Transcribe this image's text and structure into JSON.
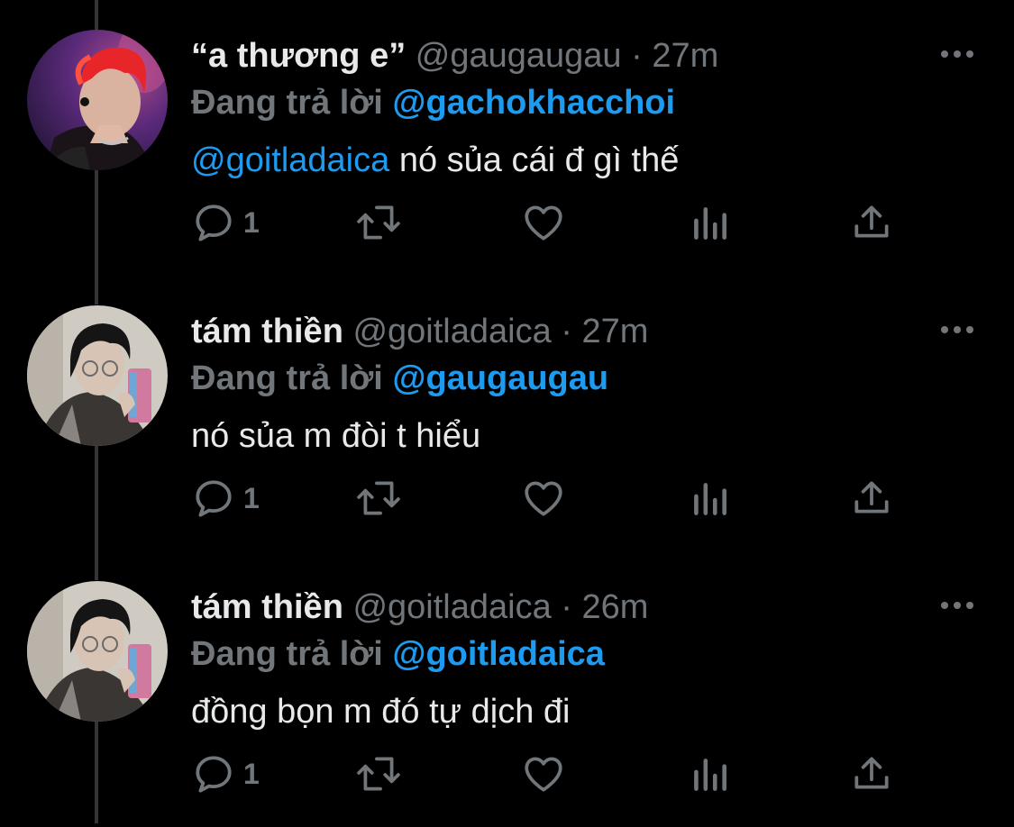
{
  "tweets": [
    {
      "display_name": "“a thương e”",
      "handle": "@gaugaugau",
      "separator": "·",
      "time": "27m",
      "reply_prefix": "Đang trả lời",
      "reply_to": "@gachokhacchoi",
      "mention": "@goitladaica",
      "body": "nó sủa cái đ gì thế",
      "reply_count": "1",
      "avatar": "red-hair-performer-avatar"
    },
    {
      "display_name": "tám thiền",
      "handle": "@goitladaica",
      "separator": "·",
      "time": "27m",
      "reply_prefix": "Đang trả lời",
      "reply_to": "@gaugaugau",
      "mention": "",
      "body": "nó sủa m đòi t hiểu",
      "reply_count": "1",
      "avatar": "mirror-selfie-avatar"
    },
    {
      "display_name": "tám thiền",
      "handle": "@goitladaica",
      "separator": "·",
      "time": "26m",
      "reply_prefix": "Đang trả lời",
      "reply_to": "@goitladaica",
      "mention": "",
      "body": "đồng bọn m đó tự dịch đi",
      "reply_count": "1",
      "avatar": "mirror-selfie-avatar"
    }
  ],
  "colors": {
    "background": "#000000",
    "primary_text": "#e7e9ea",
    "secondary_text": "#71767b",
    "link": "#1d9bf0",
    "thread_line": "#333639"
  },
  "icons": [
    "more-icon",
    "reply-icon",
    "retweet-icon",
    "like-icon",
    "views-icon",
    "share-icon"
  ]
}
